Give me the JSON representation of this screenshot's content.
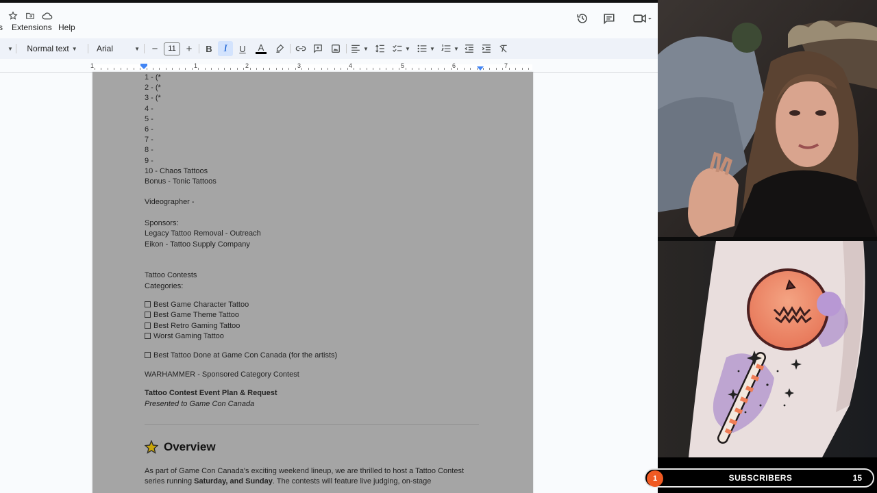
{
  "menubar": {
    "menus": [
      "s",
      "Extensions",
      "Help"
    ],
    "icons": [
      "star-icon",
      "move-to-folder-icon",
      "cloud-status-icon",
      "version-history-icon",
      "comment-icon",
      "meet-icon"
    ]
  },
  "toolbar": {
    "style": "Normal text",
    "font": "Arial",
    "font_size": "11",
    "minus": "−",
    "plus": "+",
    "bold": "B",
    "italic": "I",
    "underline": "U",
    "text_color": "A"
  },
  "ruler": {
    "numbers": [
      "1",
      "1",
      "2",
      "3",
      "4",
      "5",
      "6",
      "7"
    ]
  },
  "document": {
    "lines": [
      "1 - (*",
      "2 - (*",
      "3 - (*",
      "4 -",
      "5 -",
      "6 -",
      "7 -",
      "8 -",
      "9 -",
      "10 - Chaos Tattoos",
      "Bonus - Tonic Tattoos",
      "Videographer -",
      "Sponsors:",
      "Legacy Tattoo Removal - Outreach",
      "Eikon - Tattoo Supply Company",
      "Tattoo Contests",
      "Categories:"
    ],
    "checklist": [
      "Best Game Character Tattoo",
      "Best Game Theme Tattoo",
      "Best Retro Gaming Tattoo",
      "Worst Gaming Tattoo"
    ],
    "checklist_extra": "Best Tattoo Done at Game Con Canada (for the artists)",
    "warhammer": "WARHAMMER - Sponsored Category Contest",
    "plan_title": "Tattoo Contest Event Plan & Request",
    "plan_subtitle": "Presented to Game Con Canada",
    "overview_heading": "Overview",
    "overview_p1": "As part of Game Con Canada's exciting weekend lineup, we are thrilled to host a Tattoo Contest",
    "overview_p2_a": "series running ",
    "overview_p2_b": "Saturday, and Sunday",
    "overview_p2_c": ". The contests will feature live judging, on-stage"
  },
  "overlay": {
    "subscribers_label": "SUBSCRIBERS",
    "subscribers_count": "15",
    "badge": "1"
  },
  "colors": {
    "docs_bg": "#f9fbfd",
    "toolbar_bg": "#eef2f9",
    "page_dimmed": "#a5a5a5",
    "badge_orange": "#f05a22"
  }
}
